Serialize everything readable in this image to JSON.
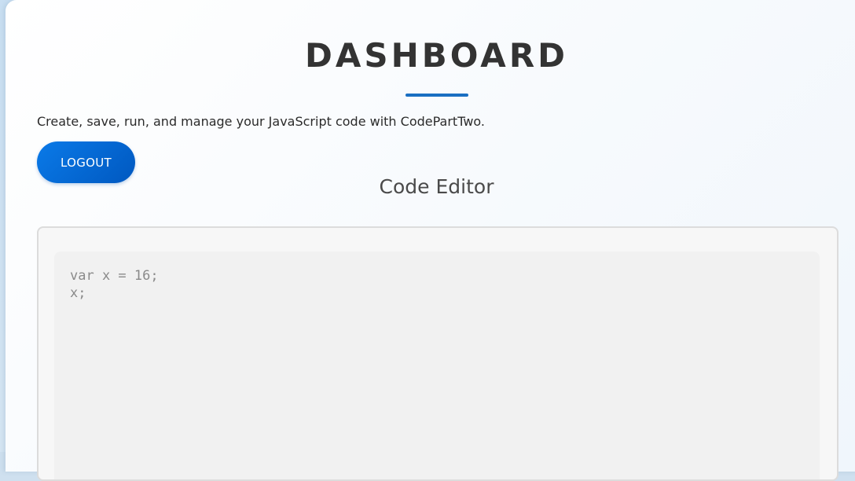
{
  "header": {
    "title": "DASHBOARD",
    "description": "Create, save, run, and manage your JavaScript code with CodePartTwo."
  },
  "actions": {
    "logout_label": "LOGOUT"
  },
  "editor": {
    "section_title": "Code Editor",
    "code_lines": [
      "var x = 16;",
      "x;"
    ]
  },
  "colors": {
    "accent": "#1a6fc2",
    "button_start": "#0a7ae8",
    "button_end": "#0058c0",
    "title_text": "#333333"
  }
}
